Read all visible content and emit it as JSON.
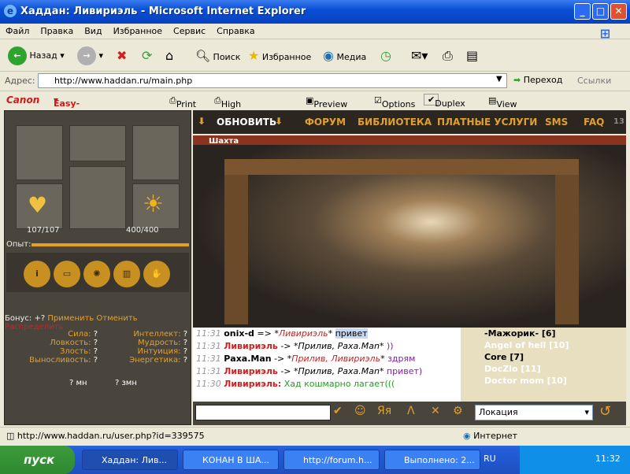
{
  "window": {
    "title": "Хаддан: Ливириэль - Microsoft Internet Explorer"
  },
  "menu": [
    "Файл",
    "Правка",
    "Вид",
    "Избранное",
    "Сервис",
    "Справка"
  ],
  "toolbar": {
    "back": "Назад",
    "search": "Поиск",
    "favorites": "Избранное",
    "media": "Медиа"
  },
  "address": {
    "label": "Адрес:",
    "url": "http://www.haddan.ru/main.php",
    "go": "Переход",
    "links": "Ссылки"
  },
  "printbar": {
    "brand1": "Canon",
    "brand2": "Easy-WebPrint",
    "print": "Print",
    "hsprint": "High Speed Print",
    "preview": "Preview",
    "options": "Options",
    "duplex": "Duplex",
    "viewlist": "View Print List"
  },
  "game": {
    "hp": "107/107",
    "mana": "400/400",
    "exp_label": "Опыт:",
    "nav": {
      "refresh": "ОБНОВИТЬ",
      "forum": "ФОРУМ",
      "library": "БИБЛИОТЕКА",
      "paid": "ПЛАТНЫЕ УСЛУГИ",
      "sms": "SMS",
      "faq": "FAQ",
      "num": "13"
    },
    "location_tab": "Шахта",
    "bonus": {
      "label": "Бонус:",
      "value": "+?",
      "apply": "Применить",
      "cancel": "Отменить",
      "distribute": "Распределить"
    },
    "stats_left": [
      {
        "name": "Сила:",
        "v": "?"
      },
      {
        "name": "Ловкость:",
        "v": "?"
      },
      {
        "name": "Злость:",
        "v": "?"
      },
      {
        "name": "Выносливость:",
        "v": "?"
      }
    ],
    "stats_right": [
      {
        "name": "Интеллект:",
        "v": "?"
      },
      {
        "name": "Мудрость:",
        "v": "?"
      },
      {
        "name": "Интуиция:",
        "v": "?"
      },
      {
        "name": "Энергетика:",
        "v": "?"
      }
    ],
    "mn": "? мн",
    "zmn": "? змн",
    "chat": [
      {
        "time": "11:31",
        "from": "onix-d",
        "arrow": " => *",
        "to": "Ливириэль",
        "end": "* ",
        "msg": "привет"
      },
      {
        "time": "11:31",
        "from": "Ливириэль",
        "arrow": " -> *",
        "to": "Прилив, Раха.Man",
        "end": "* ",
        "msg": "))"
      },
      {
        "time": "11:31",
        "from": "Раха.Man",
        "arrow": " -> *",
        "to": "Прилив, Ливириэль",
        "end": "* ",
        "msg": "здрям"
      },
      {
        "time": "11:31",
        "from": "Ливириэль",
        "arrow": " -> *",
        "to": "Прилив, Раха.Man",
        "end": "* ",
        "msg": "привет)"
      },
      {
        "time": "11:30",
        "from": "Ливириэль:",
        "arrow": "",
        "to": "",
        "end": " ",
        "msg": "Хад кошмарно лагает((("
      }
    ],
    "players": [
      "-Мажорик- [6]",
      "Angel of hell [10]",
      "Core [7]",
      "DocZlo [11]",
      "Doctor mom [10]"
    ],
    "location_select": "Локация"
  },
  "status": {
    "url": "http://www.haddan.ru/user.php?id=339575",
    "zone": "Интернет"
  },
  "taskbar": {
    "start": "пуск",
    "tasks": [
      "Хаддан: Лив...",
      "КОНАН В ША...",
      "http://forum.h...",
      "Выполнено: 2..."
    ],
    "lang": "RU",
    "clock": "11:32"
  }
}
